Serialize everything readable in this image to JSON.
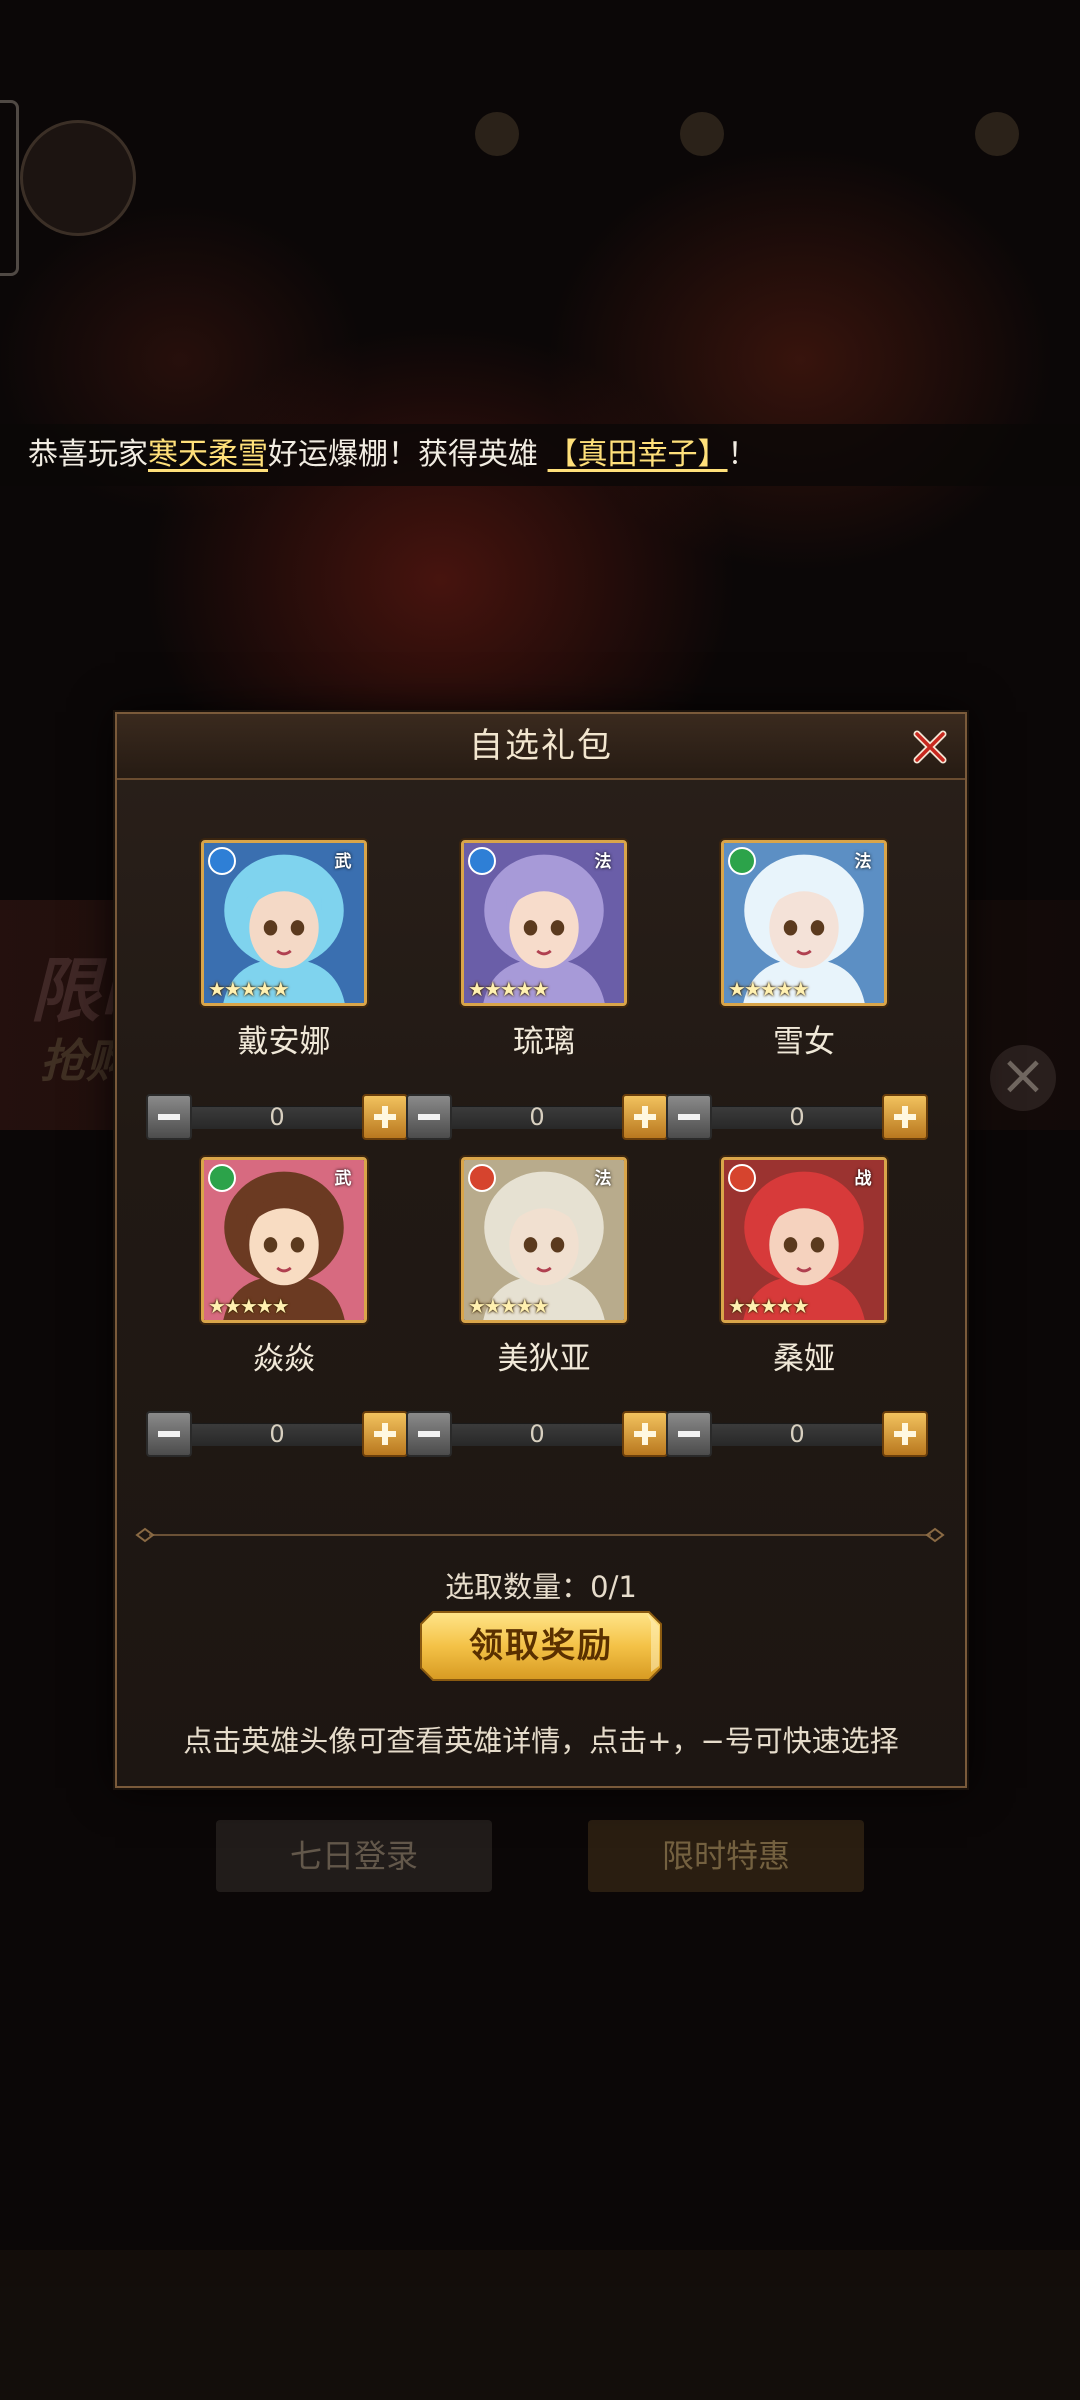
{
  "marquee": {
    "prefix": "恭喜玩家",
    "player": "寒天柔雪",
    "middle": "好运爆棚！获得英雄",
    "hero": "【真田幸子】",
    "suffix": "！"
  },
  "background": {
    "banner_text_1": "限时",
    "banner_text_2": "抢购超值",
    "tab_1": "七日登录",
    "tab_2": "限时特惠"
  },
  "dialog": {
    "title": "自选礼包",
    "heroes": [
      {
        "name": "戴安娜",
        "count": "0",
        "stars": "★★★★★",
        "role_badge": "武",
        "element_color": "#2e7fd6",
        "hair_color": "#7fd3ee",
        "skin_color": "#f4d9c6",
        "bg_color": "#3a6fb0"
      },
      {
        "name": "琉璃",
        "count": "0",
        "stars": "★★★★★",
        "role_badge": "法",
        "element_color": "#2e7fd6",
        "hair_color": "#a79ad8",
        "skin_color": "#f7dccb",
        "bg_color": "#6a5ea8"
      },
      {
        "name": "雪女",
        "count": "0",
        "stars": "★★★★★",
        "role_badge": "法",
        "element_color": "#2ca34a",
        "hair_color": "#e8f4fb",
        "skin_color": "#f4e2d8",
        "bg_color": "#5c8fc4"
      },
      {
        "name": "焱焱",
        "count": "0",
        "stars": "★★★★★",
        "role_badge": "武",
        "element_color": "#2ca34a",
        "hair_color": "#6b3a22",
        "skin_color": "#f8dcc2",
        "bg_color": "#d76a80"
      },
      {
        "name": "美狄亚",
        "count": "0",
        "stars": "★★★★★",
        "role_badge": "法",
        "element_color": "#d6442e",
        "hair_color": "#e6e1d2",
        "skin_color": "#f1e0d0",
        "bg_color": "#b8ab8c"
      },
      {
        "name": "桑娅",
        "count": "0",
        "stars": "★★★★★",
        "role_badge": "战",
        "element_color": "#d6442e",
        "hair_color": "#d73a3a",
        "skin_color": "#f5d2be",
        "bg_color": "#9b3330"
      }
    ],
    "select_count": "选取数量：0/1",
    "claim_label": "领取奖励",
    "hint": "点击英雄头像可查看英雄详情，点击+，−号可快速选择"
  },
  "colors": {
    "accent_gold": "#f2c25e",
    "highlight_text": "#ffe07a",
    "frame_border": "#7a5a3a"
  }
}
